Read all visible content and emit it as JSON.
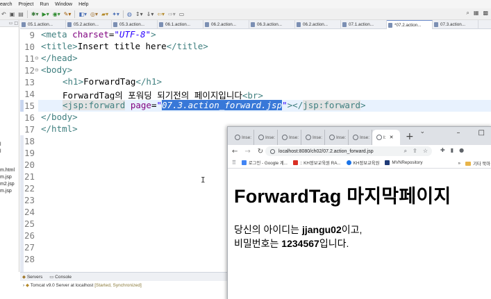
{
  "eclipse": {
    "menu": [
      "earch",
      "Project",
      "Run",
      "Window",
      "Help"
    ],
    "left_pane_items": [
      "m.html",
      "m.jsp",
      "m2.jsp",
      "m.jsp"
    ],
    "left_pane_stub": "l",
    "editor_tabs": [
      {
        "label": "05.1.action...",
        "active": false
      },
      {
        "label": "05.2.action...",
        "active": false
      },
      {
        "label": "05.3.action...",
        "active": false
      },
      {
        "label": "06.1.action...",
        "active": false
      },
      {
        "label": "06.2.action...",
        "active": false
      },
      {
        "label": "06.3.action...",
        "active": false
      },
      {
        "label": "06.2.action...",
        "active": false
      },
      {
        "label": "07.1.action...",
        "active": false
      },
      {
        "label": "*07.2.action...",
        "active": true
      },
      {
        "label": "07.3.action...",
        "active": false
      }
    ],
    "line_numbers": [
      "9",
      "10",
      "11",
      "12",
      "13",
      "14",
      "15",
      "16",
      "17",
      "18",
      "19",
      "20",
      "21",
      "22",
      "23",
      "24",
      "25",
      "26",
      "27",
      "28"
    ],
    "code": {
      "l9_tag_open": "<meta",
      "l9_attr": " charset",
      "l9_eq": "=",
      "l9_val": "\"UTF-8\"",
      "l9_close": ">",
      "l10_open": "<title>",
      "l10_text": "Insert title here",
      "l10_close": "</title>",
      "l11": "</head>",
      "l12": "<body>",
      "l13_open": "<h1>",
      "l13_text": "ForwardTag",
      "l13_close": "</h1>",
      "l14_text": "ForwardTag의 포워딩 되기전의 페이지입니다",
      "l14_br": "<br>",
      "l15_open": "<jsp:forward",
      "l15_attr": " page",
      "l15_eq": "=",
      "l15_q1": "\"",
      "l15_sel": "07.3.action_forward.jsp",
      "l15_q2": "\"",
      "l15_gt": "></",
      "l15_close": "jsp:forward",
      "l15_end": ">",
      "l16": "</body>",
      "l17": "</html>"
    },
    "console": {
      "tab_servers": "Servers",
      "tab_console": "Console",
      "server_name": "Tomcat v9.0 Server at localhost",
      "server_status": "[Started, Synchronized]"
    }
  },
  "browser": {
    "tabs": [
      {
        "label": "Inse:",
        "active": false
      },
      {
        "label": "Inse:",
        "active": false
      },
      {
        "label": "Inse:",
        "active": false
      },
      {
        "label": "Inse:",
        "active": false
      },
      {
        "label": "Inse:",
        "active": false
      },
      {
        "label": "Inse:",
        "active": false
      },
      {
        "label": "I:",
        "active": true
      }
    ],
    "url": "localhost:8080/ch02/07.2.action_forward.jsp",
    "bookmarks": [
      {
        "label": "로그인 - Google 계...",
        "color": "#4285f4"
      },
      {
        "label": ":: KH정보교육원 RA...",
        "color": "#d93025"
      },
      {
        "label": "KH정보교육원",
        "color": "#1a73e8"
      },
      {
        "label": "MVNRepository",
        "color": "#1f3b78"
      }
    ],
    "bookmark_folder": "기타 북마",
    "page": {
      "heading": "ForwardTag 마지막페이지",
      "line1_prefix": "당신의 아이디는 ",
      "line1_id": "jjangu02",
      "line1_suffix": "이고,",
      "line2_prefix": "비밀번호는 ",
      "line2_pw": "1234567",
      "line2_suffix": "입니다."
    }
  }
}
